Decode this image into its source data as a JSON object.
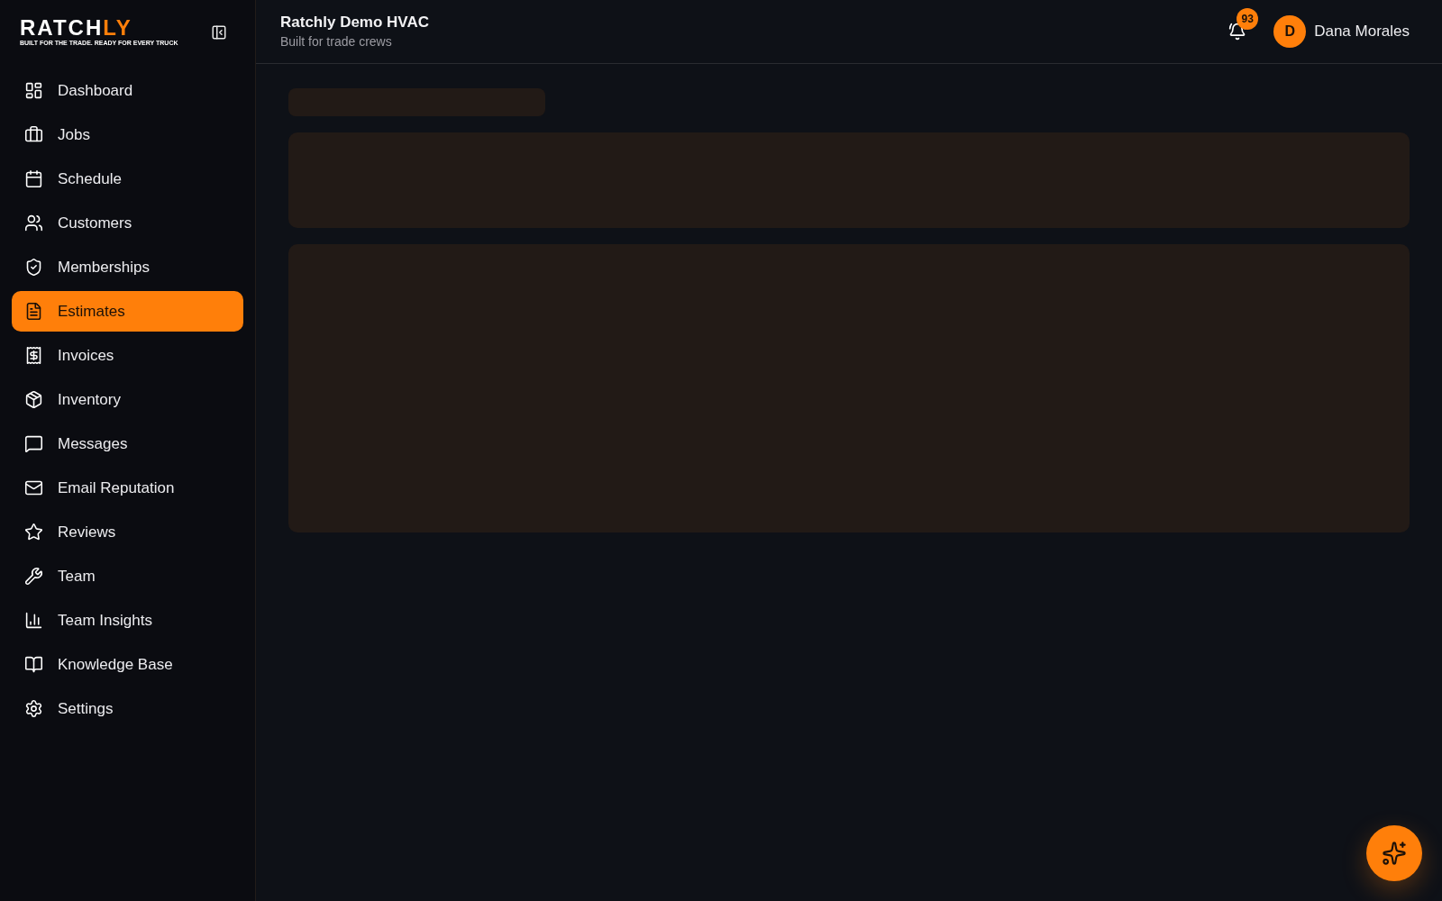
{
  "sidebar": {
    "logo": {
      "wordmark": "RATCH",
      "wordmark_accent": "LY",
      "tagline": "BUILT FOR THE TRADE. READY FOR EVERY TRUCK"
    },
    "items": [
      {
        "label": "Dashboard",
        "selected": false
      },
      {
        "label": "Jobs",
        "selected": false
      },
      {
        "label": "Schedule",
        "selected": false
      },
      {
        "label": "Customers",
        "selected": false
      },
      {
        "label": "Memberships",
        "selected": false
      },
      {
        "label": "Estimates",
        "selected": true
      },
      {
        "label": "Invoices",
        "selected": false
      },
      {
        "label": "Inventory",
        "selected": false
      },
      {
        "label": "Messages",
        "selected": false
      },
      {
        "label": "Email Reputation",
        "selected": false
      },
      {
        "label": "Reviews",
        "selected": false
      },
      {
        "label": "Team",
        "selected": false
      },
      {
        "label": "Team Insights",
        "selected": false
      },
      {
        "label": "Knowledge Base",
        "selected": false
      },
      {
        "label": "Settings",
        "selected": false
      }
    ]
  },
  "header": {
    "title": "Ratchly Demo HVAC",
    "subtitle": "Built for trade crews",
    "notifications": {
      "badge": "93"
    },
    "user": {
      "avatar_initial": "D",
      "name": "Dana Morales"
    }
  },
  "content": {
    "placeholders": [
      {
        "kind": "heading"
      },
      {
        "kind": "card"
      },
      {
        "kind": "panel"
      }
    ]
  }
}
